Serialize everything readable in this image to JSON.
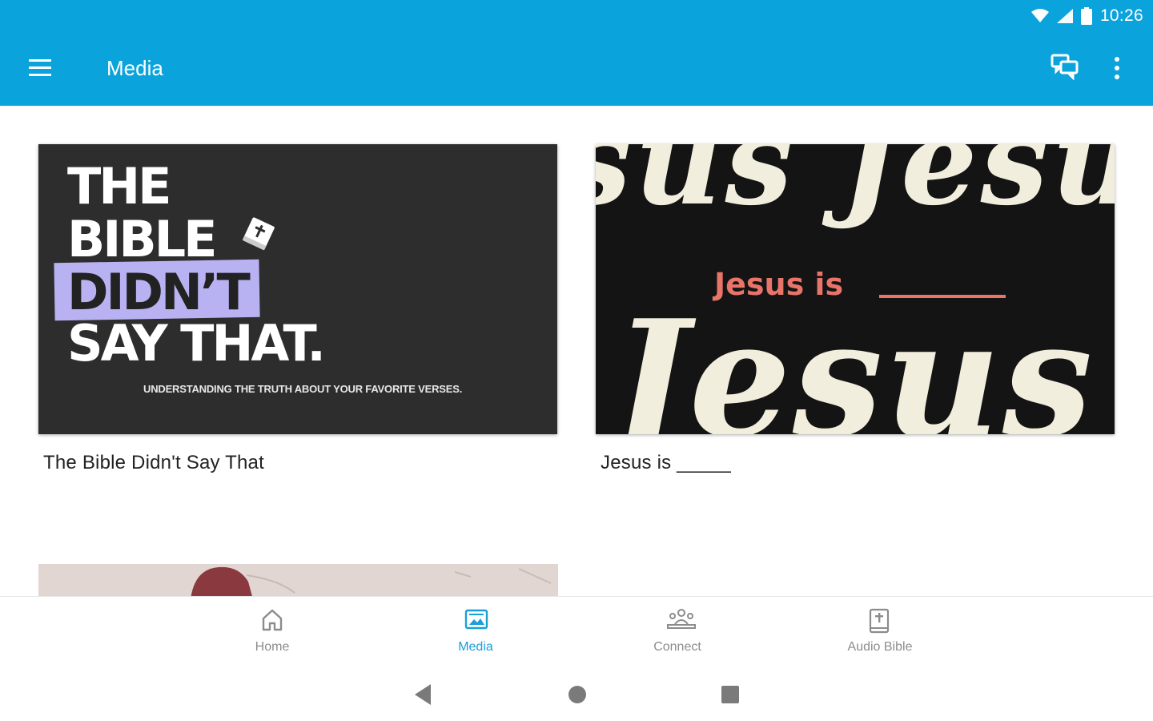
{
  "status_bar": {
    "time": "10:26",
    "icons": [
      "wifi-icon",
      "cell-signal-icon",
      "battery-icon"
    ]
  },
  "app_bar": {
    "title": "Media",
    "background": "#0aa3dc",
    "menu_icon": "hamburger-menu-icon",
    "actions": [
      "chat-bubbles-icon",
      "more-vert-icon"
    ]
  },
  "media_items": [
    {
      "title": "The Bible Didn't Say That",
      "artwork": {
        "lines": [
          "THE",
          "BIBLE",
          "DIDN’T",
          "SAY THAT."
        ],
        "subtitle": "UNDERSTANDING THE TRUTH ABOUT YOUR FAVORITE VERSES.",
        "highlight_color": "#b9b2f2"
      }
    },
    {
      "title": "Jesus is _____",
      "artwork": {
        "headline": "Jesus is",
        "background_word_top": "sus Jesu",
        "background_word_bottom": "Jesus J",
        "accent_color": "#e8746a"
      }
    }
  ],
  "bottom_nav": {
    "items": [
      {
        "label": "Home",
        "icon": "home-icon"
      },
      {
        "label": "Media",
        "icon": "image-icon",
        "active": true
      },
      {
        "label": "Connect",
        "icon": "people-group-icon"
      },
      {
        "label": "Audio Bible",
        "icon": "bible-book-icon"
      }
    ],
    "active_color": "#1a9fd9"
  },
  "system_nav": {
    "buttons": [
      "back-icon",
      "home-circle-icon",
      "recents-square-icon"
    ]
  }
}
